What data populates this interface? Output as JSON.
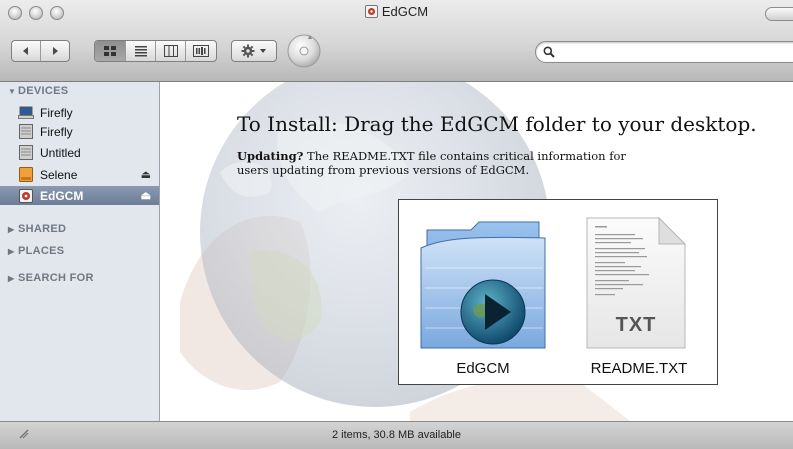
{
  "window": {
    "title": "EdGCM"
  },
  "toolbar": {
    "back_icon": "chevron-left-icon",
    "forward_icon": "chevron-right-icon",
    "view_modes": [
      "icon-view",
      "list-view",
      "column-view",
      "cover-flow-view"
    ],
    "active_view": "icon-view",
    "action_icon": "gear-icon",
    "search_value": "",
    "search_placeholder": ""
  },
  "sidebar": {
    "sections": [
      {
        "label": "DEVICES",
        "expanded": true
      },
      {
        "label": "SHARED",
        "expanded": false
      },
      {
        "label": "PLACES",
        "expanded": false
      },
      {
        "label": "SEARCH FOR",
        "expanded": false
      }
    ],
    "devices": [
      {
        "label": "Firefly",
        "icon": "laptop-icon",
        "eject": false,
        "selected": false
      },
      {
        "label": "Firefly",
        "icon": "hard-drive-icon",
        "eject": false,
        "selected": false
      },
      {
        "label": "Untitled",
        "icon": "hard-drive-icon",
        "eject": false,
        "selected": false
      },
      {
        "label": "Selene",
        "icon": "external-drive-icon",
        "eject": true,
        "selected": false
      },
      {
        "label": "EdGCM",
        "icon": "disk-image-icon",
        "eject": true,
        "selected": true
      }
    ]
  },
  "content": {
    "install_heading": "To Install: Drag the EdGCM folder to your desktop.",
    "update_bold": "Updating?",
    "update_line1": " The README.TXT file contains critical information for",
    "update_line2": "users updating from previous versions of EdGCM.",
    "items": [
      {
        "label": "EdGCM",
        "icon": "application-folder-icon"
      },
      {
        "label": "README.TXT",
        "icon": "text-document-icon",
        "badge": "TXT"
      }
    ]
  },
  "status_bar": {
    "text": "2 items, 30.8 MB available"
  },
  "colors": {
    "sidebar_bg": "#e2e7ed",
    "selection": "#6c7d96",
    "folder_blue": "#5f95d6"
  }
}
